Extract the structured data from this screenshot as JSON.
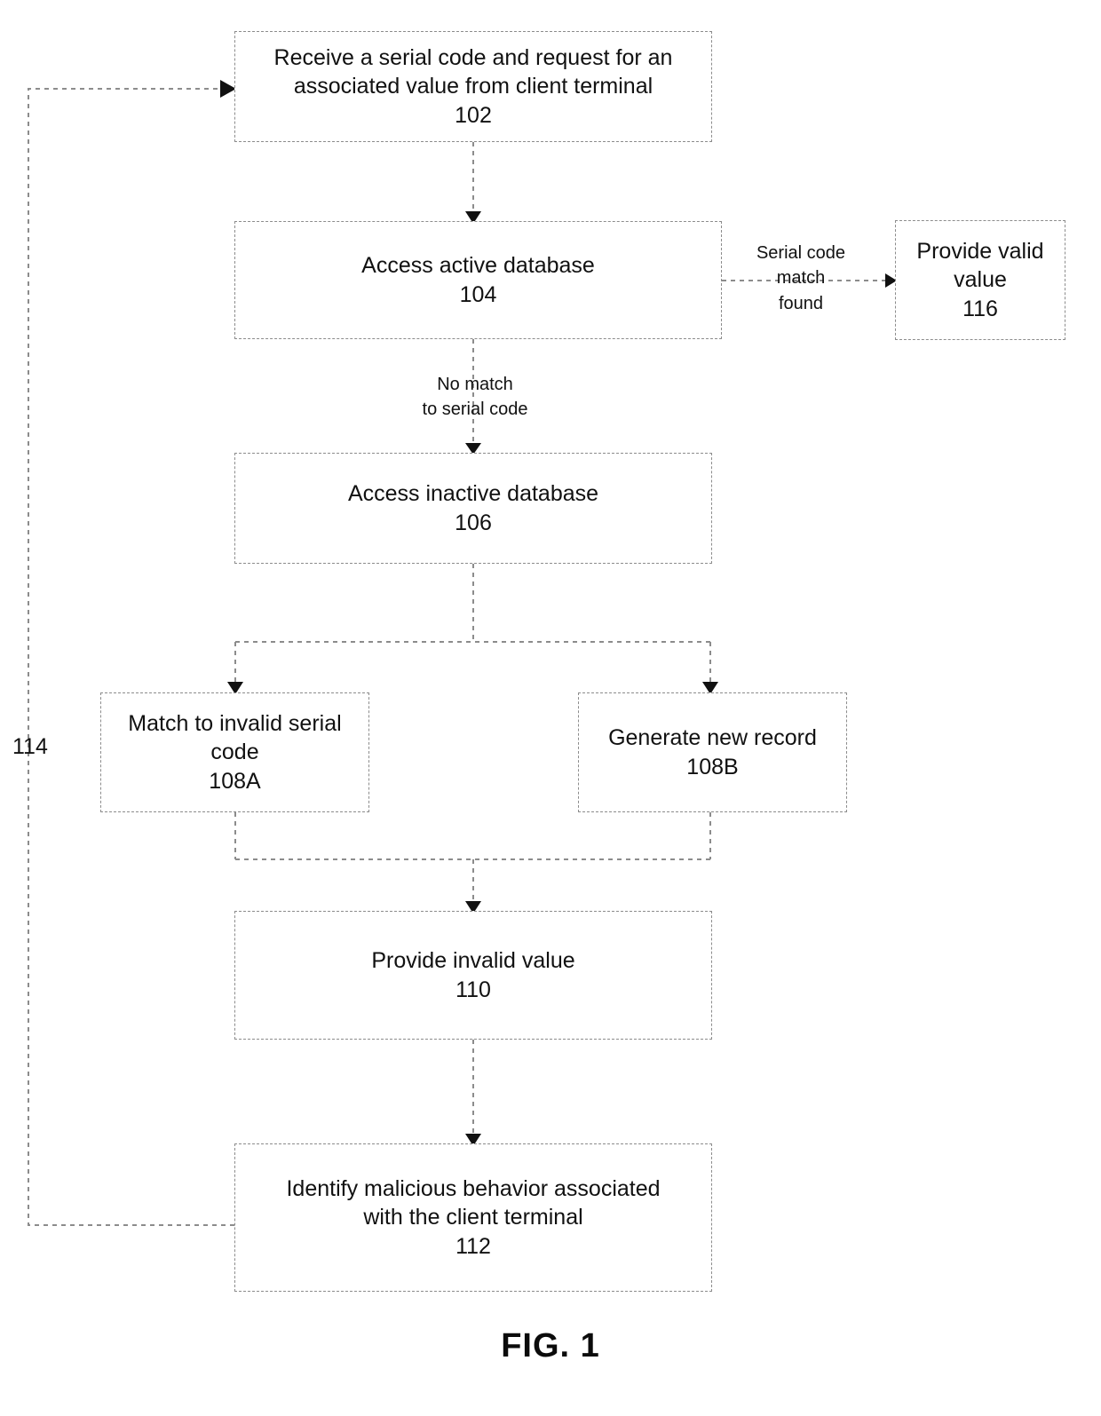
{
  "figure": {
    "caption": "FIG. 1",
    "reference_numeral_loop": "114"
  },
  "nodes": [
    {
      "id": "102",
      "name": "receive-serial-code",
      "line1": "Receive a serial code and request for an",
      "line2": "associated value from client terminal",
      "number": "102"
    },
    {
      "id": "104",
      "name": "access-active-database",
      "line1": "Access active database",
      "number": "104"
    },
    {
      "id": "116",
      "name": "provide-valid-value",
      "line1": "Provide valid",
      "line2": "value",
      "number": "116"
    },
    {
      "id": "106",
      "name": "access-inactive-database",
      "line1": "Access inactive database",
      "number": "106"
    },
    {
      "id": "108A",
      "name": "match-invalid-serial-code",
      "line1": "Match to invalid serial",
      "line2": "code",
      "number": "108A"
    },
    {
      "id": "108B",
      "name": "generate-new-record",
      "line1": "Generate new record",
      "number": "108B"
    },
    {
      "id": "110",
      "name": "provide-invalid-value",
      "line1": "Provide invalid value",
      "number": "110"
    },
    {
      "id": "112",
      "name": "identify-malicious-behavior",
      "line1": "Identify malicious behavior associated",
      "line2": "with the client terminal",
      "number": "112"
    }
  ],
  "edge_labels": {
    "match_found": {
      "line1": "Serial code",
      "line2": "match",
      "line3": "found"
    },
    "no_match": {
      "line1": "No match",
      "line2": "to serial code"
    }
  },
  "colors": {
    "box_border": "#8c8c8c",
    "connector": "#8c8c8c",
    "text": "#111111",
    "background": "#ffffff"
  }
}
